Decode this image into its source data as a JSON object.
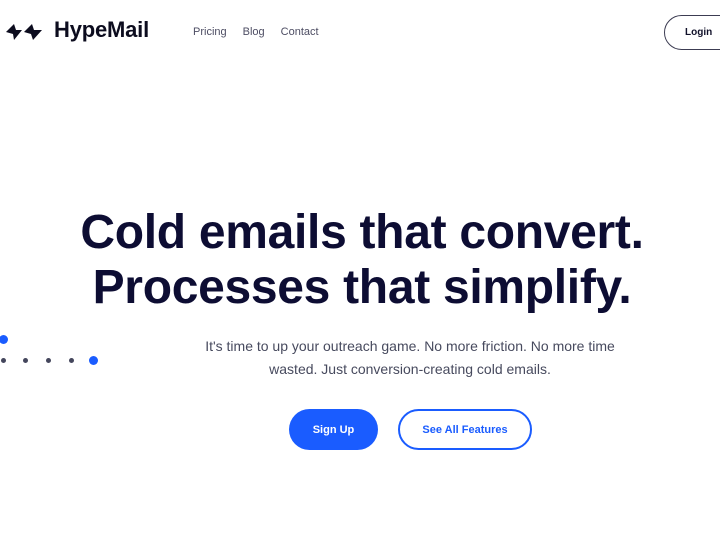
{
  "nav": {
    "brand": "HypeMail",
    "logo_icon": "double-lightning-icon",
    "links": [
      "Pricing",
      "Blog",
      "Contact"
    ],
    "login_label": "Login"
  },
  "hero": {
    "title_line1": "Cold emails that convert.",
    "title_line2": "Processes that simplify.",
    "subtitle": "It's time to up your outreach game. No more friction. No more time wasted. Just conversion-creating cold emails.",
    "primary_cta": "Sign Up",
    "secondary_cta": "See All Features"
  },
  "decor": {
    "dots_icon": "dot-pattern-icon",
    "accent_color": "#1a5cff",
    "muted_dot_color": "#44465c"
  }
}
